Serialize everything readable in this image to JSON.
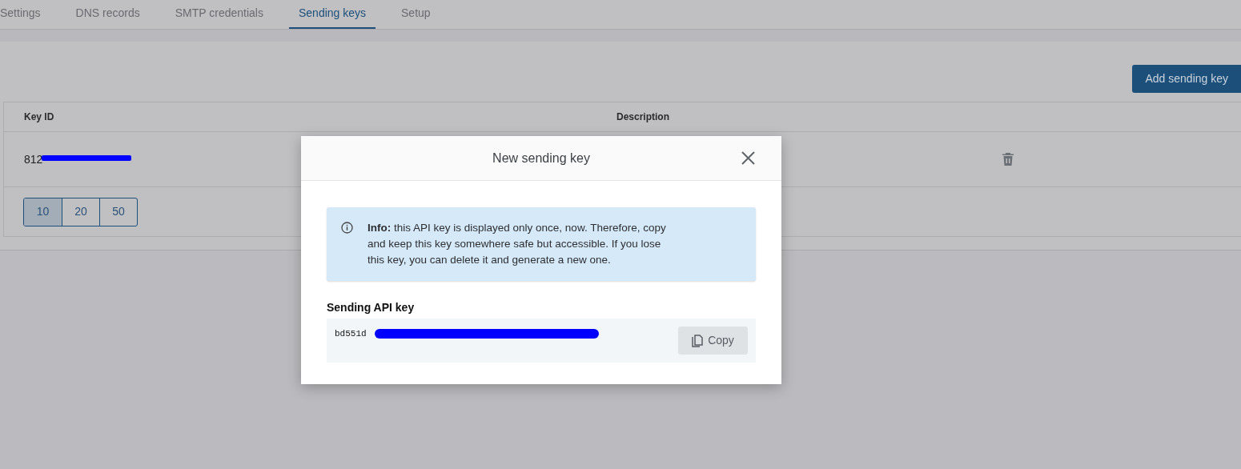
{
  "tabs": [
    {
      "label": "Settings",
      "selected": false
    },
    {
      "label": "DNS records",
      "selected": false
    },
    {
      "label": "SMTP credentials",
      "selected": false
    },
    {
      "label": "Sending keys",
      "selected": true
    },
    {
      "label": "Setup",
      "selected": false
    }
  ],
  "add_button": "Add sending key",
  "table": {
    "columns": [
      "Key ID",
      "Description"
    ],
    "rows": [
      {
        "key_id": "812",
        "redacted": true
      }
    ]
  },
  "pagination": [
    {
      "label": "10",
      "selected": true
    },
    {
      "label": "20",
      "selected": false
    },
    {
      "label": "50",
      "selected": false
    }
  ],
  "dialog": {
    "title": "New sending key",
    "info": "**Info:** this API key is displayed only once, now. Therefore, copy and keep this key somewhere safe but accessible. If you lose this key, you can delete it and generate a new one.",
    "key_label": "Sending API key",
    "key_value": "bd551d",
    "key_redacted": true,
    "copy_button": "Copy"
  }
}
